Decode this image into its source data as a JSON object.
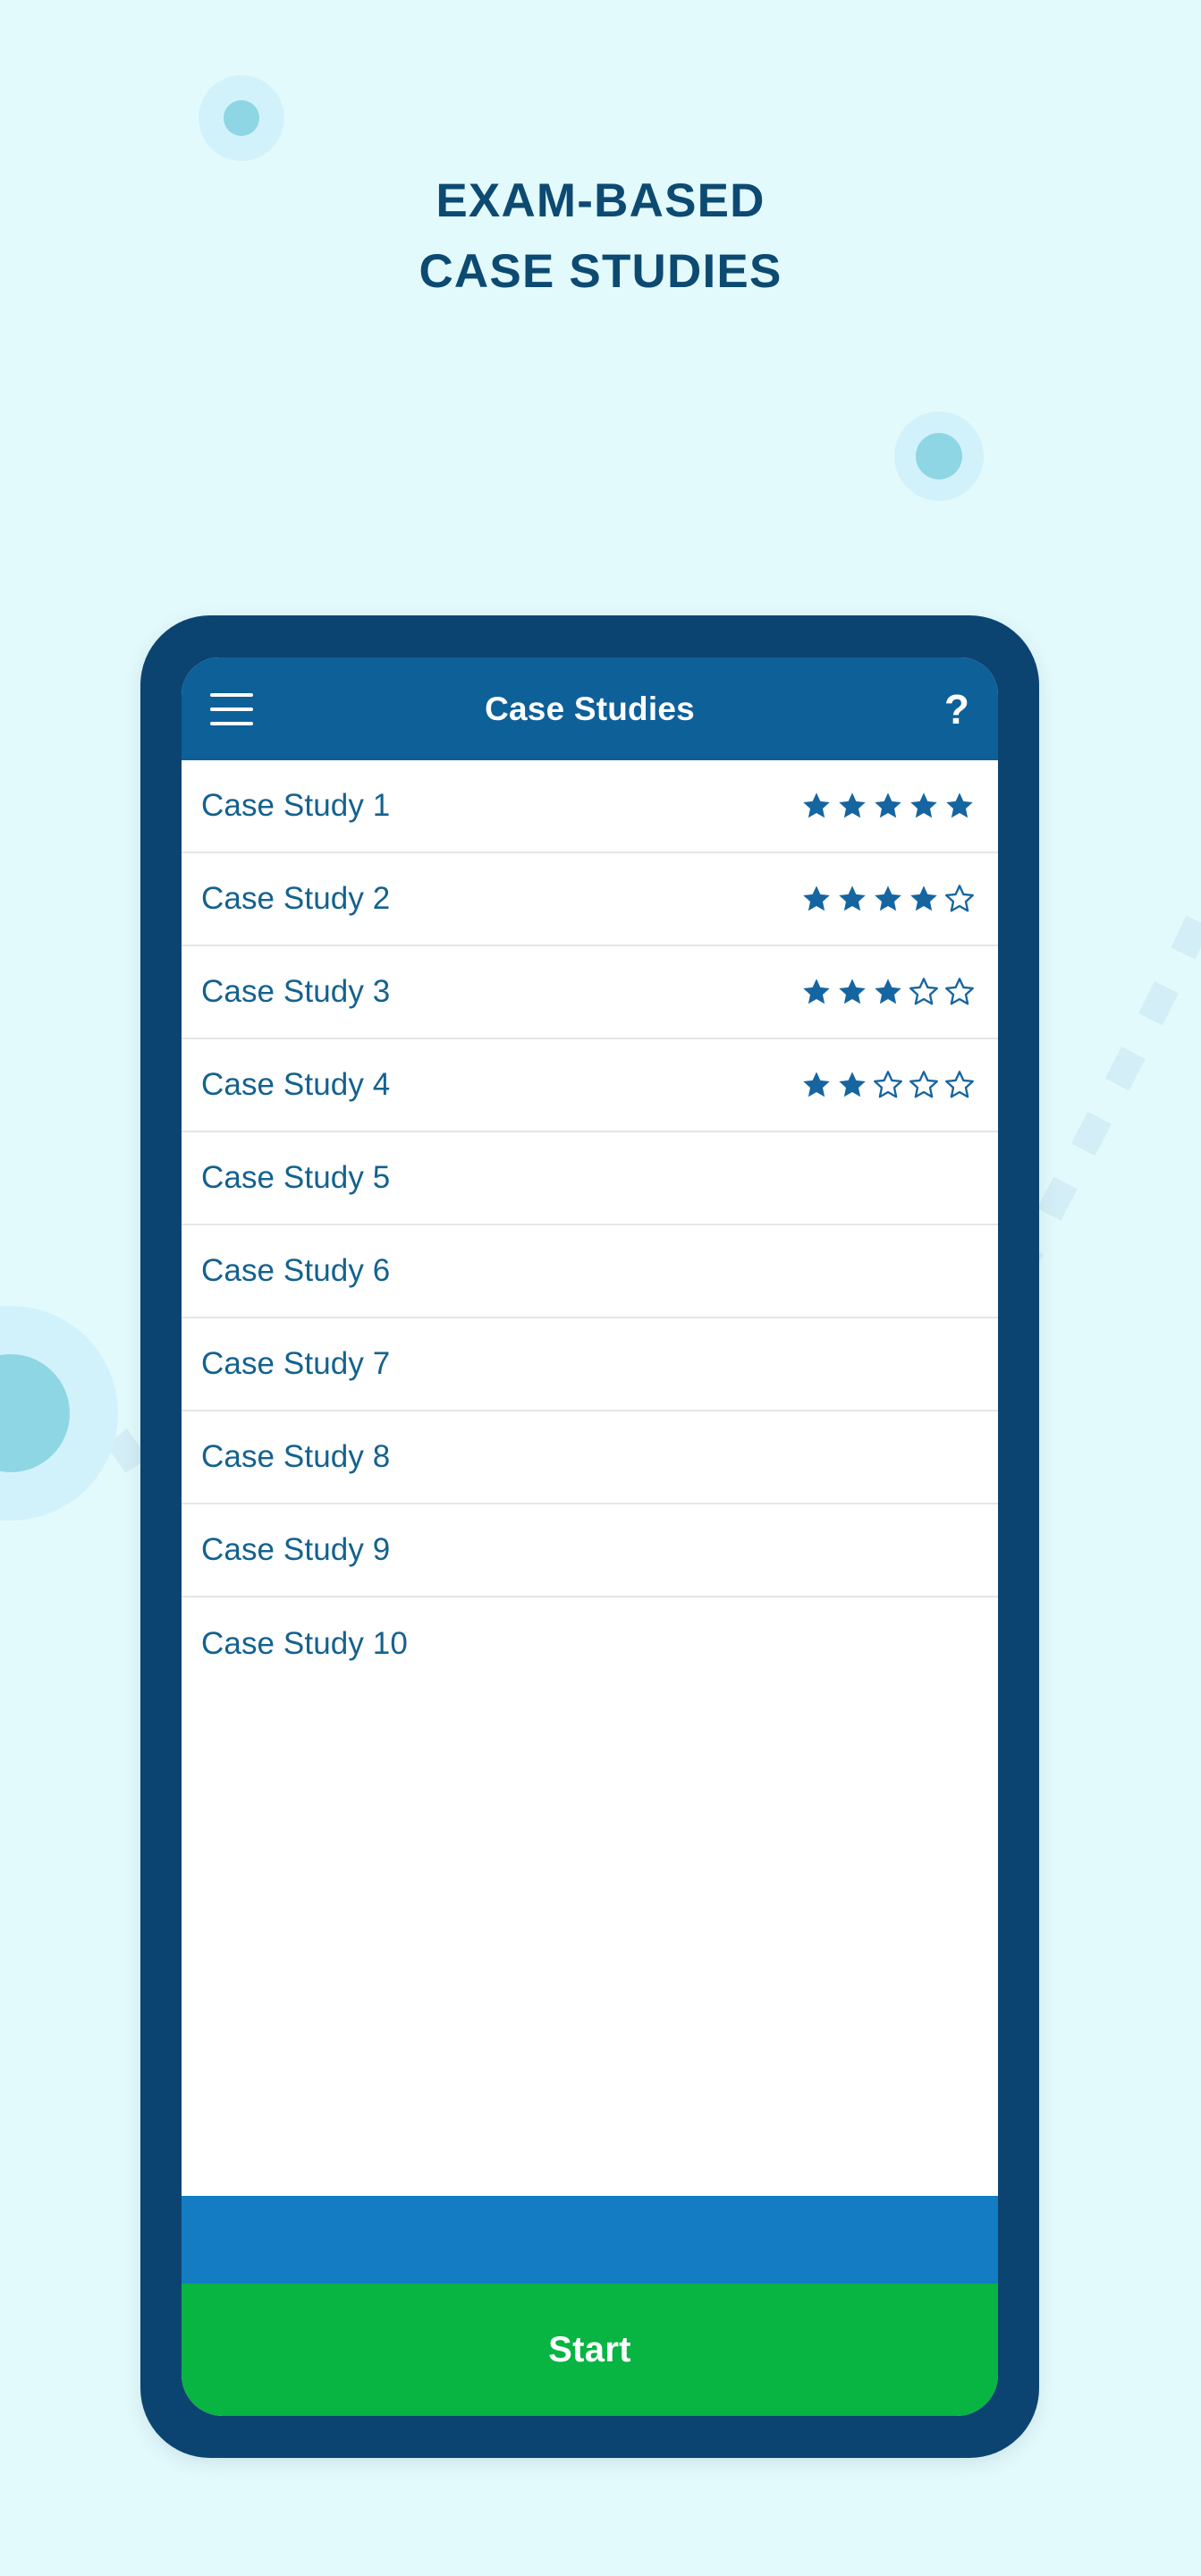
{
  "headline": {
    "line1": "EXAM-BASED",
    "line2": "CASE STUDIES",
    "color": "#0d4a72"
  },
  "colors": {
    "page_background": "#e3fafc",
    "phone_bezel": "#0c4471",
    "appbar": "#0e6099",
    "accent_blue": "#137cc2",
    "star_blue": "#1565a0",
    "list_text": "#14628f",
    "start_green": "#08b442",
    "decor_halo": "#d2f2fb",
    "decor_core": "#8ed6e3"
  },
  "app": {
    "appbar": {
      "menu_icon": "hamburger-menu-icon",
      "title": "Case Studies",
      "help_icon": "?"
    },
    "list": {
      "max_stars": 5,
      "rows": [
        {
          "label": "Case Study 1",
          "stars": 5
        },
        {
          "label": "Case Study 2",
          "stars": 4
        },
        {
          "label": "Case Study 3",
          "stars": 3
        },
        {
          "label": "Case Study 4",
          "stars": 2
        },
        {
          "label": "Case Study 5",
          "stars": 0
        },
        {
          "label": "Case Study 6",
          "stars": 0
        },
        {
          "label": "Case Study 7",
          "stars": 0
        },
        {
          "label": "Case Study 8",
          "stars": 0
        },
        {
          "label": "Case Study 9",
          "stars": 0
        },
        {
          "label": "Case Study 10",
          "stars": 0
        }
      ]
    },
    "footer": {
      "start_label": "Start"
    }
  },
  "decorations": {
    "dots": [
      {
        "name": "decor-dot-top-left"
      },
      {
        "name": "decor-dot-mid-right"
      },
      {
        "name": "decor-dot-left-edge"
      }
    ],
    "arcs": [
      {
        "name": "decor-dashed-arc-right"
      },
      {
        "name": "decor-dashed-arc-left"
      }
    ]
  }
}
